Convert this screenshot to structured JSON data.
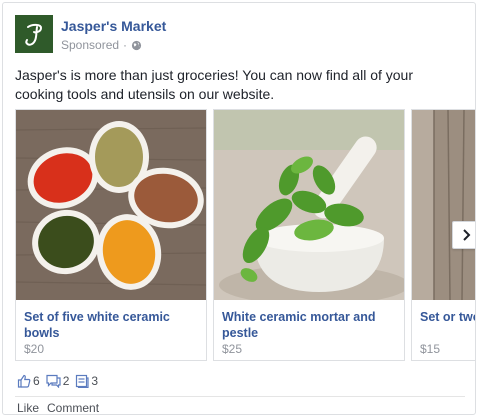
{
  "ad": {
    "page_name": "Jasper's Market",
    "sponsored": "Sponsored",
    "separator": "·",
    "body_text": "Jasper's is more than just groceries! You can now find all of your cooking tools and utensils on our website."
  },
  "carousel": {
    "items": [
      {
        "title": "Set of five white ceramic bowls",
        "price": "$20",
        "image": "spice-bowls-photo"
      },
      {
        "title": "White ceramic mortar and pestle",
        "price": "$25",
        "image": "mortar-pestle-basil-photo"
      },
      {
        "title": "Set or two utensils",
        "price": "$15",
        "image": "wooden-board-photo"
      }
    ],
    "next_icon": "chevron-right-icon"
  },
  "engagement": {
    "likes": "6",
    "comments": "2",
    "shares": "3"
  },
  "actions": {
    "like_label": "Like",
    "comment_label": "Comment"
  },
  "colors": {
    "link_blue": "#365899",
    "meta_gray": "#90949c",
    "logo_green": "#2f5a2a"
  }
}
